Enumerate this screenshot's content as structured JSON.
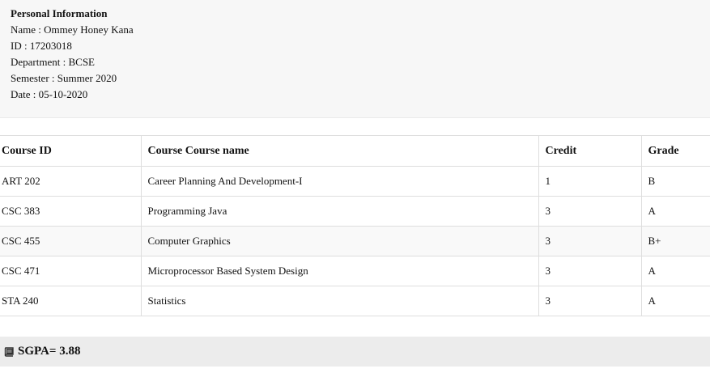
{
  "personal_info": {
    "title": "Personal Information",
    "name": "Name : Ommey Honey Kana",
    "id": "ID : 17203018",
    "department": "Department : BCSE",
    "semester": "Semester : Summer 2020",
    "date": "Date : 05-10-2020"
  },
  "table": {
    "headers": [
      "Course ID",
      "Course Course name",
      "Credit",
      "Grade"
    ],
    "rows": [
      [
        "ART 202",
        "Career Planning And Development-I",
        "1",
        "B"
      ],
      [
        "CSC 383",
        "Programming Java",
        "3",
        "A"
      ],
      [
        "CSC 455",
        "Computer Graphics",
        "3",
        "B+"
      ],
      [
        "CSC 471",
        "Microprocessor Based System Design",
        "3",
        "A"
      ],
      [
        "STA 240",
        "Statistics",
        "3",
        "A"
      ]
    ]
  },
  "summary": {
    "icon": "book-icon",
    "sgpa_label": "SGPA= 3.88"
  }
}
